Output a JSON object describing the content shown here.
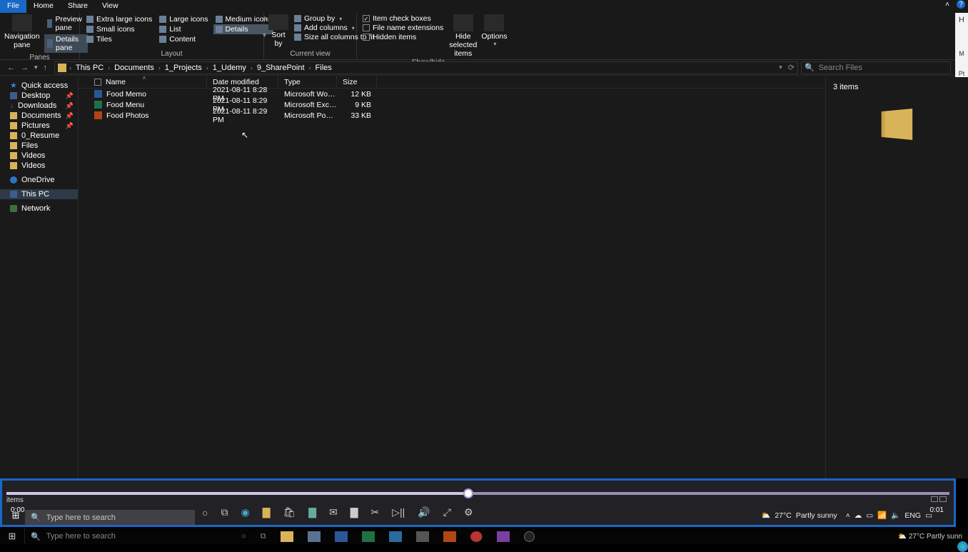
{
  "tabs": {
    "file": "File",
    "home": "Home",
    "share": "Share",
    "view": "View"
  },
  "ribbon": {
    "panes": {
      "navigation": "Navigation\npane",
      "preview": "Preview pane",
      "details": "Details pane",
      "label": "Panes"
    },
    "layout": {
      "xl": "Extra large icons",
      "lg": "Large icons",
      "md": "Medium icons",
      "sm": "Small icons",
      "list": "List",
      "details": "Details",
      "tiles": "Tiles",
      "content": "Content",
      "label": "Layout"
    },
    "current": {
      "sort": "Sort\nby",
      "group": "Group by",
      "add": "Add columns",
      "fit": "Size all columns to fit",
      "label": "Current view"
    },
    "showhide": {
      "item_cb": "Item check boxes",
      "ext": "File name extensions",
      "hidden": "Hidden items",
      "hide_sel": "Hide selected\nitems",
      "options": "Options",
      "label": "Show/hide"
    }
  },
  "breadcrumb": [
    "This PC",
    "Documents",
    "1_Projects",
    "1_Udemy",
    "9_SharePoint",
    "Files"
  ],
  "search": {
    "placeholder": "Search Files"
  },
  "sidebar": {
    "quick": "Quick access",
    "desktop": "Desktop",
    "downloads": "Downloads",
    "documents": "Documents",
    "pictures": "Pictures",
    "resume": "0_Resume",
    "files": "Files",
    "videos": "Videos",
    "videos2": "Videos",
    "onedrive": "OneDrive",
    "thispc": "This PC",
    "network": "Network"
  },
  "columns": {
    "name": "Name",
    "date": "Date modified",
    "type": "Type",
    "size": "Size"
  },
  "files": [
    {
      "icon": "word",
      "name": "Food Memo",
      "date": "2021-08-11 8:28 PM",
      "type": "Microsoft Word D...",
      "size": "12 KB"
    },
    {
      "icon": "excel",
      "name": "Food Menu",
      "date": "2021-08-11 8:29 PM",
      "type": "Microsoft Excel W...",
      "size": "9 KB"
    },
    {
      "icon": "ppt",
      "name": "Food Photos",
      "date": "2021-08-11 8:29 PM",
      "type": "Microsoft PowerP...",
      "size": "33 KB"
    }
  ],
  "details": {
    "count": "3 items"
  },
  "edge": {
    "h": "H",
    "p": "Pt",
    "m": "M"
  },
  "video": {
    "items": "items",
    "t0": "0:00",
    "t1": "0:01",
    "search": "Type here to search",
    "weather_t": "27°C",
    "weather_s": "Partly sunny",
    "lang": "ENG"
  },
  "taskbar": {
    "search": "Type here to search"
  }
}
